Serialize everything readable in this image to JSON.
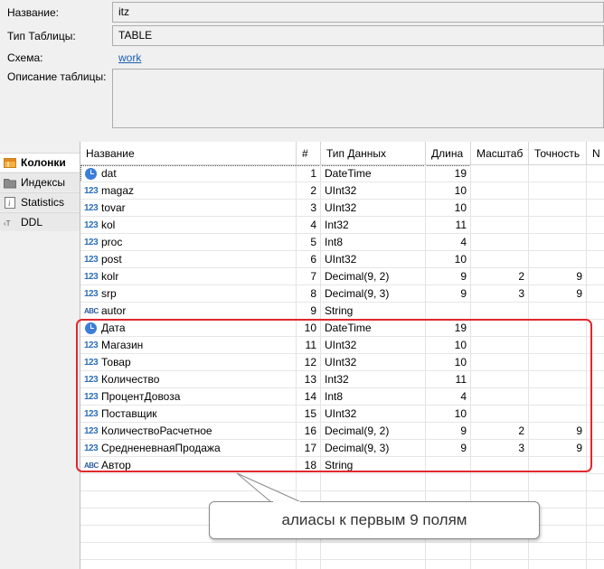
{
  "form": {
    "name_label": "Название:",
    "name_value": "itz",
    "type_label": "Тип Таблицы:",
    "type_value": "TABLE",
    "schema_label": "Схема:",
    "schema_value": "work",
    "desc_label": "Описание таблицы:",
    "desc_value": ""
  },
  "tabs": [
    {
      "label": "Колонки",
      "icon": "columns-icon",
      "active": true
    },
    {
      "label": "Индексы",
      "icon": "folder-icon",
      "active": false
    },
    {
      "label": "Statistics",
      "icon": "info-icon",
      "active": false
    },
    {
      "label": "DDL",
      "icon": "ddl-icon",
      "active": false
    }
  ],
  "grid": {
    "headers": [
      "Название",
      "#",
      "Тип Данных",
      "Длина",
      "Масштаб",
      "Точность",
      "N"
    ],
    "rows": [
      {
        "icon": "datetime",
        "name": "dat",
        "num": "1",
        "type": "DateTime",
        "length": "19",
        "scale": "",
        "precision": ""
      },
      {
        "icon": "number",
        "name": "magaz",
        "num": "2",
        "type": "UInt32",
        "length": "10",
        "scale": "",
        "precision": ""
      },
      {
        "icon": "number",
        "name": "tovar",
        "num": "3",
        "type": "UInt32",
        "length": "10",
        "scale": "",
        "precision": ""
      },
      {
        "icon": "number",
        "name": "kol",
        "num": "4",
        "type": "Int32",
        "length": "11",
        "scale": "",
        "precision": ""
      },
      {
        "icon": "number",
        "name": "proc",
        "num": "5",
        "type": "Int8",
        "length": "4",
        "scale": "",
        "precision": ""
      },
      {
        "icon": "number",
        "name": "post",
        "num": "6",
        "type": "UInt32",
        "length": "10",
        "scale": "",
        "precision": ""
      },
      {
        "icon": "number",
        "name": "kolr",
        "num": "7",
        "type": "Decimal(9, 2)",
        "length": "9",
        "scale": "2",
        "precision": "9"
      },
      {
        "icon": "number",
        "name": "srp",
        "num": "8",
        "type": "Decimal(9, 3)",
        "length": "9",
        "scale": "3",
        "precision": "9"
      },
      {
        "icon": "string",
        "name": "autor",
        "num": "9",
        "type": "String",
        "length": "",
        "scale": "",
        "precision": ""
      },
      {
        "icon": "datetime",
        "name": "Дата",
        "num": "10",
        "type": "DateTime",
        "length": "19",
        "scale": "",
        "precision": ""
      },
      {
        "icon": "number",
        "name": "Магазин",
        "num": "11",
        "type": "UInt32",
        "length": "10",
        "scale": "",
        "precision": ""
      },
      {
        "icon": "number",
        "name": "Товар",
        "num": "12",
        "type": "UInt32",
        "length": "10",
        "scale": "",
        "precision": ""
      },
      {
        "icon": "number",
        "name": "Количество",
        "num": "13",
        "type": "Int32",
        "length": "11",
        "scale": "",
        "precision": ""
      },
      {
        "icon": "number",
        "name": "ПроцентДовоза",
        "num": "14",
        "type": "Int8",
        "length": "4",
        "scale": "",
        "precision": ""
      },
      {
        "icon": "number",
        "name": "Поставщик",
        "num": "15",
        "type": "UInt32",
        "length": "10",
        "scale": "",
        "precision": ""
      },
      {
        "icon": "number",
        "name": "КоличествоРасчетное",
        "num": "16",
        "type": "Decimal(9, 2)",
        "length": "9",
        "scale": "2",
        "precision": "9"
      },
      {
        "icon": "number",
        "name": "СредненевнаяПродажа",
        "num": "17",
        "type": "Decimal(9, 3)",
        "length": "9",
        "scale": "3",
        "precision": "9"
      },
      {
        "icon": "string",
        "name": "Автор",
        "num": "18",
        "type": "String",
        "length": "",
        "scale": "",
        "precision": ""
      }
    ]
  },
  "annotation": {
    "text": "алиасы к первым 9 полям",
    "color": "#e0282e"
  },
  "icon_text": {
    "number": "123",
    "string": "ABC"
  }
}
